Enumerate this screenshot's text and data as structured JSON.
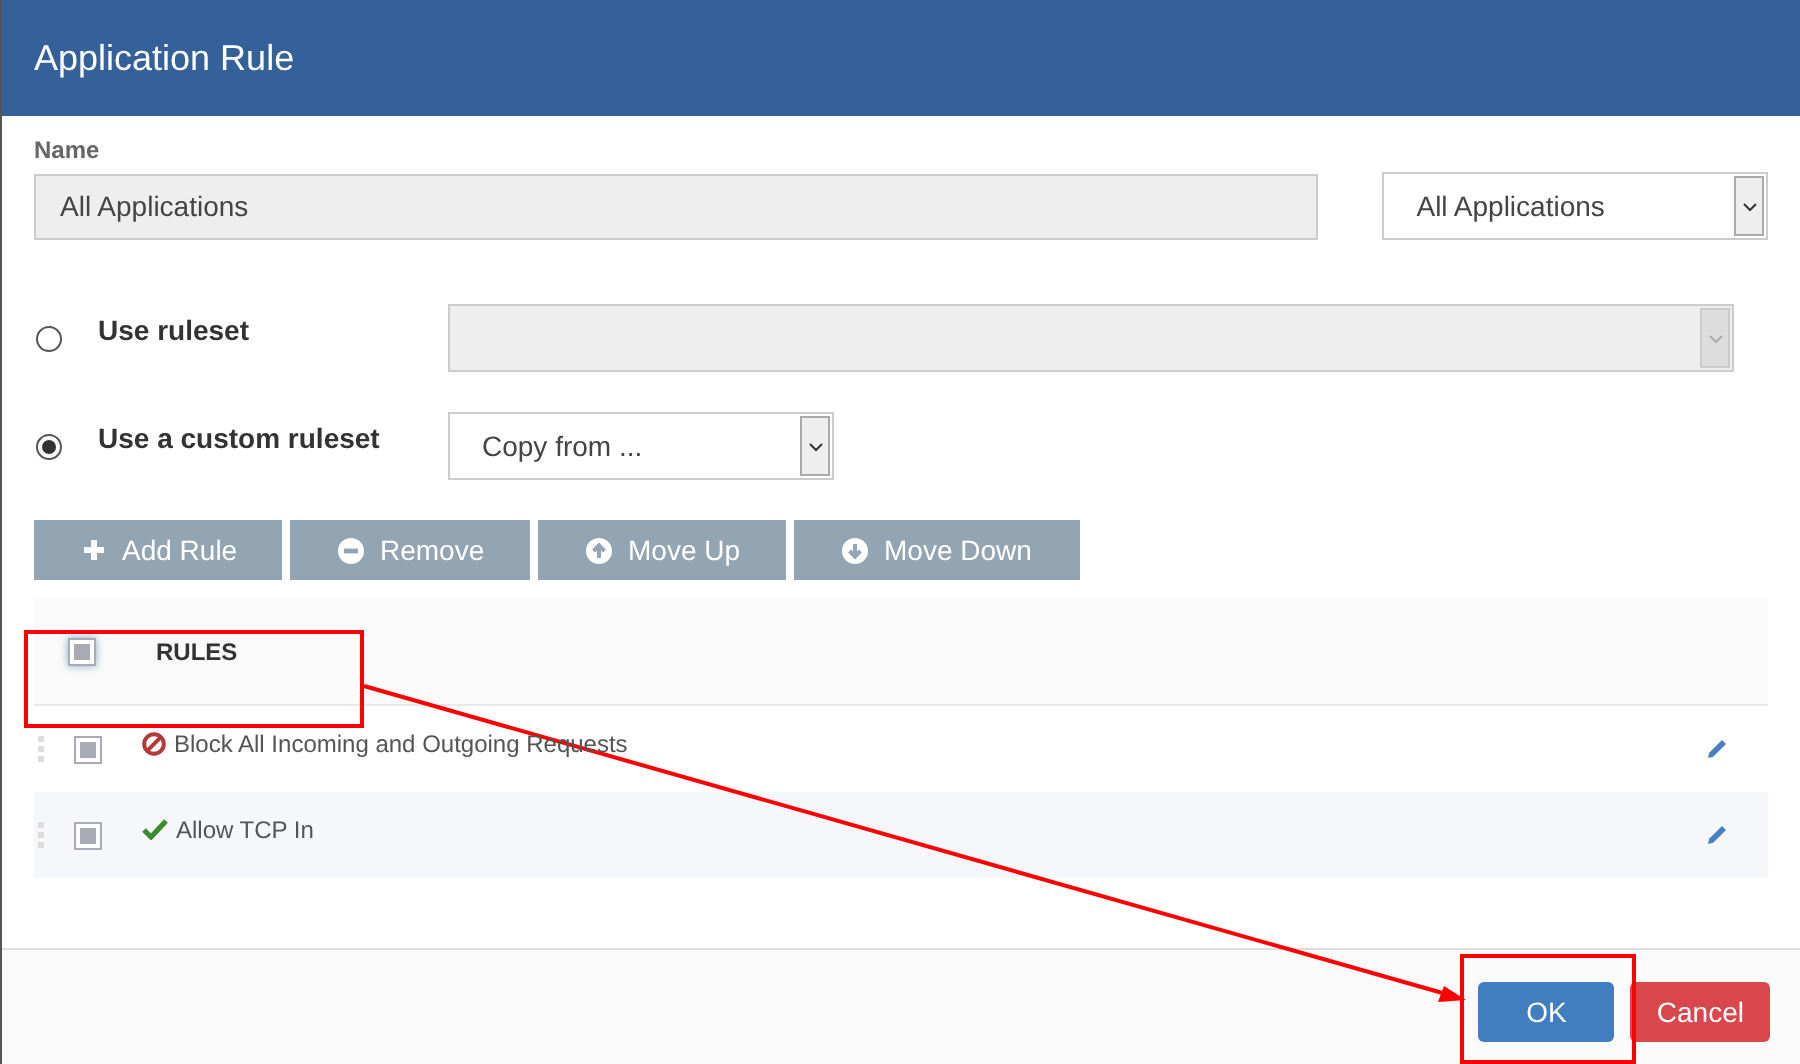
{
  "window": {
    "title": "Application Rule"
  },
  "name_field": {
    "label": "Name",
    "value": "All Applications",
    "disabled": true
  },
  "scope_select": {
    "value": "All Applications"
  },
  "ruleset_options": [
    {
      "label": "Use ruleset",
      "selected": false,
      "select": {
        "disabled": true
      }
    },
    {
      "label": "Use a custom ruleset",
      "selected": true,
      "select": {
        "value": "Copy from ...",
        "disabled": false
      }
    }
  ],
  "toolbar": [
    {
      "label": "Add Rule",
      "kind": "add"
    },
    {
      "label": "Remove",
      "kind": "remove"
    },
    {
      "label": "Move Up",
      "kind": "up"
    },
    {
      "label": "Move Down",
      "kind": "down"
    }
  ],
  "rules_table": {
    "header": {
      "label": "RULES",
      "checked": false
    },
    "rows": [
      {
        "label": "Block All Incoming and Outgoing Requests",
        "kind": "block",
        "checked": false
      },
      {
        "label": "Allow TCP In",
        "kind": "allow",
        "checked": false
      }
    ]
  },
  "footer_buttons": [
    {
      "label": "OK",
      "kind": "primary"
    },
    {
      "label": "Cancel",
      "kind": "danger"
    }
  ]
}
